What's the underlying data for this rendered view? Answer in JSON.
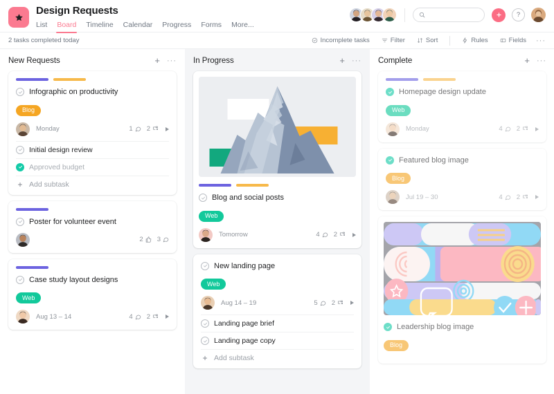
{
  "header": {
    "logo_icon": "star-icon",
    "project_title": "Design Requests",
    "tabs": [
      {
        "label": "List",
        "active": false
      },
      {
        "label": "Board",
        "active": true
      },
      {
        "label": "Timeline",
        "active": false
      },
      {
        "label": "Calendar",
        "active": false
      },
      {
        "label": "Progress",
        "active": false
      },
      {
        "label": "Forms",
        "active": false
      },
      {
        "label": "More...",
        "active": false
      }
    ],
    "search": {
      "value": "",
      "placeholder": "",
      "icon": "search-icon"
    },
    "add_button_icon": "plus-icon",
    "help_button_label": "?",
    "member_avatars": 4
  },
  "toolbar": {
    "status_text": "2 tasks completed today",
    "items": [
      {
        "label": "Incomplete tasks",
        "icon": "check-circle-icon"
      },
      {
        "label": "Filter",
        "icon": "filter-icon"
      },
      {
        "label": "Sort",
        "icon": "sort-icon"
      },
      {
        "label": "Rules",
        "icon": "bolt-icon"
      },
      {
        "label": "Fields",
        "icon": "fields-icon"
      }
    ],
    "overflow_label": "···"
  },
  "colors": {
    "accent_pink": "#fb7a90",
    "add_pink": "#fb6d84",
    "purple_tag": "#6c63e0",
    "orange_tag": "#f7b94a",
    "badge_orange": "#f5a623",
    "badge_teal": "#12c99b",
    "done_teal": "#14cba8"
  },
  "columns": [
    {
      "title": "New Requests",
      "add_icon": "plus-icon",
      "menu_icon": "ellipsis-icon",
      "highlight": false,
      "cards": [
        {
          "title": "Infographic on productivity",
          "completed": false,
          "tagbars": [
            "#6c63e0",
            "#f7b94a"
          ],
          "badge": {
            "label": "Blog",
            "color": "#f5a623"
          },
          "date": "Monday",
          "avatar": "avatar-man-beard",
          "stats": [
            {
              "count": "1",
              "icon": "comment-icon"
            },
            {
              "count": "2",
              "icon": "subtask-icon"
            }
          ],
          "expand_icon": "caret-right-icon",
          "subtasks": [
            {
              "label": "Initial design review",
              "completed": false
            },
            {
              "label": "Approved budget",
              "completed": true
            }
          ],
          "add_subtask_label": "Add subtask"
        },
        {
          "title": "Poster for volunteer event",
          "completed": false,
          "tagbars": [
            "#6c63e0"
          ],
          "badge": null,
          "date": "",
          "avatar": "avatar-man-dark",
          "stats": [
            {
              "count": "2",
              "icon": "thumbs-up-icon"
            },
            {
              "count": "3",
              "icon": "comment-icon"
            }
          ],
          "expand_icon": null,
          "subtasks": [],
          "add_subtask_label": null
        },
        {
          "title": "Case study layout designs",
          "completed": false,
          "tagbars": [
            "#6c63e0"
          ],
          "badge": {
            "label": "Web",
            "color": "#12c99b"
          },
          "date": "Aug 13 – 14",
          "avatar": "avatar-woman-long",
          "stats": [
            {
              "count": "4",
              "icon": "comment-icon"
            },
            {
              "count": "2",
              "icon": "subtask-icon"
            }
          ],
          "expand_icon": "caret-right-icon",
          "subtasks": [],
          "add_subtask_label": null
        }
      ]
    },
    {
      "title": "In Progress",
      "add_icon": "plus-icon",
      "menu_icon": "ellipsis-icon",
      "highlight": true,
      "cards": [
        {
          "title": "Blog and social posts",
          "completed": false,
          "image": "mountain-photo",
          "tagbars": [
            "#6c63e0",
            "#f7b94a"
          ],
          "badge": {
            "label": "Web",
            "color": "#12c99b"
          },
          "date": "Tomorrow",
          "avatar": "avatar-woman-dark",
          "stats": [
            {
              "count": "4",
              "icon": "comment-icon"
            },
            {
              "count": "2",
              "icon": "subtask-icon"
            }
          ],
          "expand_icon": "caret-right-icon",
          "subtasks": [],
          "add_subtask_label": null
        },
        {
          "title": "New landing page",
          "completed": false,
          "tagbars": [],
          "badge": {
            "label": "Web",
            "color": "#12c99b"
          },
          "date": "Aug 14 – 19",
          "avatar": "avatar-man-short",
          "stats": [
            {
              "count": "5",
              "icon": "comment-icon"
            },
            {
              "count": "2",
              "icon": "subtask-icon"
            }
          ],
          "expand_icon": "caret-right-icon",
          "subtasks": [
            {
              "label": "Landing page brief",
              "completed": false
            },
            {
              "label": "Landing page copy",
              "completed": false
            }
          ],
          "add_subtask_label": "Add subtask"
        }
      ]
    },
    {
      "title": "Complete",
      "add_icon": "plus-icon",
      "menu_icon": "ellipsis-icon",
      "highlight": false,
      "cards": [
        {
          "title": "Homepage design update",
          "completed": true,
          "tagbars": [
            "#6c63e0",
            "#f7b94a"
          ],
          "badge": {
            "label": "Web",
            "color": "#12c99b"
          },
          "date": "Monday",
          "avatar": "avatar-woman-long",
          "stats": [
            {
              "count": "4",
              "icon": "comment-icon"
            },
            {
              "count": "2",
              "icon": "subtask-icon"
            }
          ],
          "expand_icon": "caret-right-icon",
          "subtasks": [],
          "add_subtask_label": null
        },
        {
          "title": "Featured blog image",
          "completed": true,
          "tagbars": [],
          "badge": {
            "label": "Blog",
            "color": "#f5a623"
          },
          "date": "Jul 19 – 30",
          "avatar": "avatar-man-beard",
          "stats": [
            {
              "count": "4",
              "icon": "comment-icon"
            },
            {
              "count": "2",
              "icon": "subtask-icon"
            }
          ],
          "expand_icon": "caret-right-icon",
          "subtasks": [],
          "add_subtask_label": null
        },
        {
          "title": "Leadership blog image",
          "completed": true,
          "image": "abstract-art",
          "tagbars": [],
          "badge": {
            "label": "Blog",
            "color": "#f5a623"
          },
          "date": "",
          "avatar": null,
          "stats": [],
          "expand_icon": null,
          "subtasks": [],
          "add_subtask_label": null
        }
      ]
    }
  ]
}
